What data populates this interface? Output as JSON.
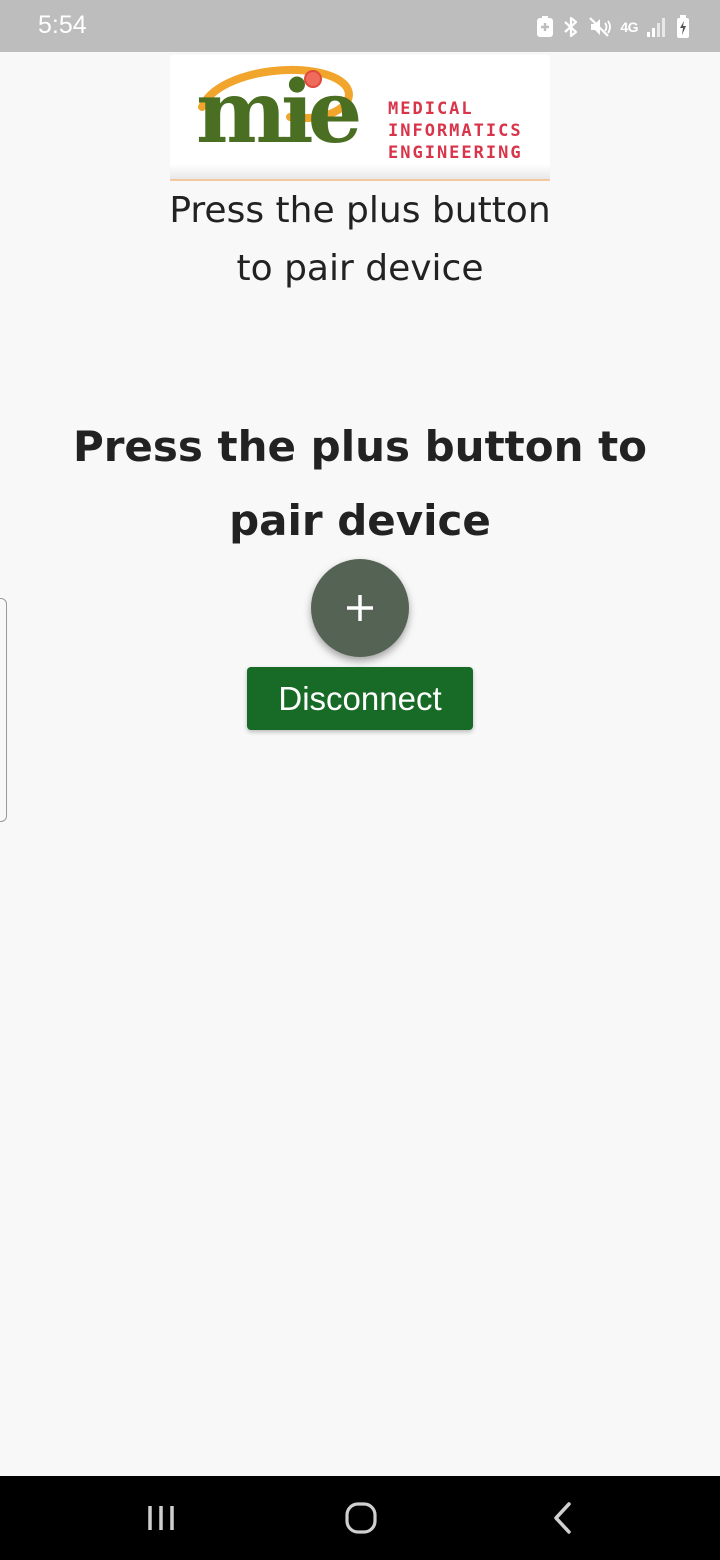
{
  "status_bar": {
    "time": "5:54",
    "network": "4G",
    "icons": [
      "data-saver-icon",
      "bluetooth-icon",
      "mute-vibrate-icon",
      "signal-icon",
      "battery-charging-icon"
    ]
  },
  "logo": {
    "word": "mie",
    "line1": "MEDICAL",
    "line2": "INFORMATICS",
    "line3": "ENGINEERING",
    "colors": {
      "word": "#4b6f22",
      "text": "#d8344a",
      "orbit": "#f2a52c"
    }
  },
  "main": {
    "subtitle_line1": "Press the plus button",
    "subtitle_line2": "to pair device",
    "heading": "Press the plus button to pair device",
    "fab_icon": "plus-icon",
    "disconnect_label": "Disconnect"
  },
  "colors": {
    "background": "#f8f8f8",
    "status_bar": "#bdbdbd",
    "fab": "#546354",
    "disconnect": "#176b26",
    "nav_bar": "#000000"
  },
  "nav_bar": {
    "icons": [
      "recents-icon",
      "home-icon",
      "back-icon"
    ]
  }
}
